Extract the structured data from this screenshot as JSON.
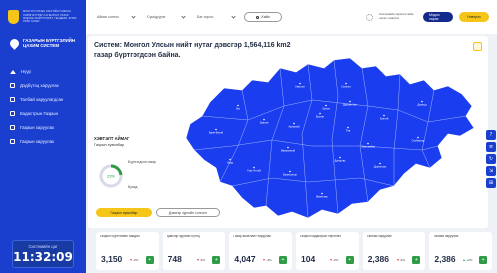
{
  "sidebar": {
    "org_text": "МОНГОЛ УЛСЫН ЗАСГИЙН ГАЗРЫН ХЭРЭГЖҮҮЛЭГЧ АГЕНТЛАГ ГАЗАР ЗОХИОН БАЙГУУЛАЛТ, ГЕОДЕЗИ, ЗУРАГ ЗҮЙН ГАЗАР",
    "brand_title": "ГАЗАРЫН БҮРТГЭЛИЙН",
    "brand_subtitle": "ЦАХИМ СИСТЕМ",
    "items": [
      {
        "label": "Нүүр",
        "icon": "home-icon"
      },
      {
        "label": "Дэдбүтэц харуулах",
        "icon": "document-icon"
      },
      {
        "label": "Талбай харуулагдсан",
        "icon": "document-icon"
      },
      {
        "label": "Кадастрын Газрын",
        "icon": "map-icon"
      },
      {
        "label": "Газрын харуулах",
        "icon": "pin-icon"
      },
      {
        "label": "Газрын харуулах",
        "icon": "layers-icon"
      }
    ],
    "clock_label": "Системийн цаг",
    "clock_time": "11:32:09"
  },
  "topbar": {
    "filters": [
      "Аймаг сонгох",
      "Сум/дүүрэг",
      "Баг хороо"
    ],
    "search_label": "Хайх",
    "user_text": "Системийн хэрэглэгчийн хэсэгт нэвтрэх",
    "primary_button": "Мэдээ харах",
    "secondary_button": "Нэвтрэх"
  },
  "main": {
    "title": "Систем: Монгол Улсын нийт нутаг дэвсгэр 1,564,116 km2 газар бүртгэгдсэн байна.",
    "info_heading": "ХЭВТЭЛТ АЙМАГ",
    "info_sub": "Газрын хувилбар",
    "donut_percent": "23%",
    "legend_registered": "Бүртгэгдсэн газар",
    "legend_other": "Бусад",
    "tab_active": "Газрын хувилбар",
    "tab_inactive": "Дэвсгэр зургийн сонголт",
    "map_color": "#1b3df0",
    "map_labels": [
      "Баян-Өлгий",
      "Увс",
      "Ховд",
      "Завхан",
      "Говь-Алтай",
      "Баянхонгор",
      "Архангай",
      "Хөвсгөл",
      "Булган",
      "Сэлэнгэ",
      "Дархан-Уул",
      "Төв",
      "Хэнтий",
      "Дорнод",
      "Сүхбаатар",
      "Дорноговь",
      "Дундговь",
      "Өмнөговь",
      "Өвөрхангай",
      "Говьсүмбэр",
      "Орхон"
    ]
  },
  "cards": [
    {
      "label": "Газрын бүртгэлийн байдал",
      "value": "3,150",
      "trend": "-2%"
    },
    {
      "label": "Дэвсгэр зургийн бүтэц",
      "value": "748",
      "trend": "-3%"
    },
    {
      "label": "Газар ашиглалт харуулах",
      "value": "4,047",
      "trend": "-3%"
    },
    {
      "label": "Газрын кадастрын хэрэглээ",
      "value": "104",
      "trend": "-2%"
    },
    {
      "label": "Талбай харуулах",
      "value": "2,386",
      "trend": "-2%"
    },
    {
      "label": "Талбай харуулах",
      "value": "2,386",
      "trend": "+2%"
    }
  ],
  "colors": {
    "sidebar": "#1a3fcf",
    "accent_yellow": "#f5c518",
    "positive": "#2e9b46",
    "negative": "#e53935"
  }
}
